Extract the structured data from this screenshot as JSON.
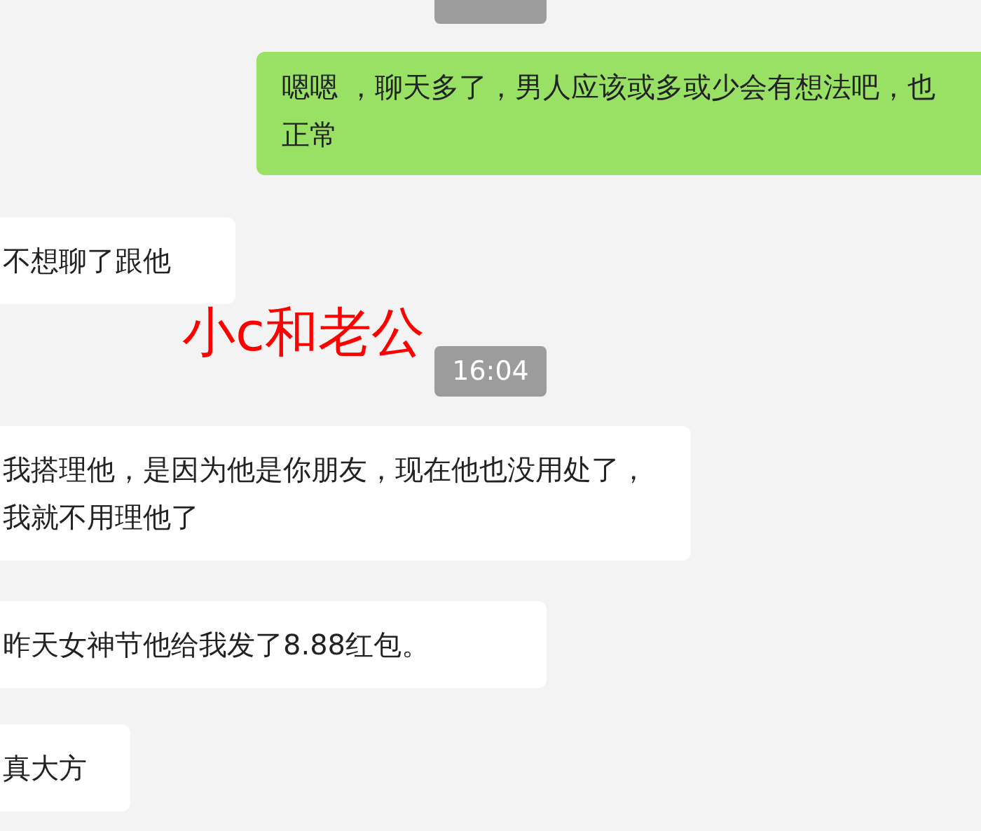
{
  "messages": [
    {
      "kind": "time"
    },
    {
      "kind": "sent",
      "text": "嗯嗯 ，聊天多了，男人应该或多或少会有想法吧，也正常"
    },
    {
      "kind": "received",
      "text": "不想聊了跟他"
    },
    {
      "kind": "time",
      "text": "16:04"
    },
    {
      "kind": "received",
      "text": "我搭理他，是因为他是你朋友，现在他也没用处了，我就不用理他了"
    },
    {
      "kind": "received",
      "text": "昨天女神节他给我发了8.88红包。"
    },
    {
      "kind": "received",
      "text": "真大方"
    }
  ],
  "annotation": {
    "text": "小c和老公"
  }
}
